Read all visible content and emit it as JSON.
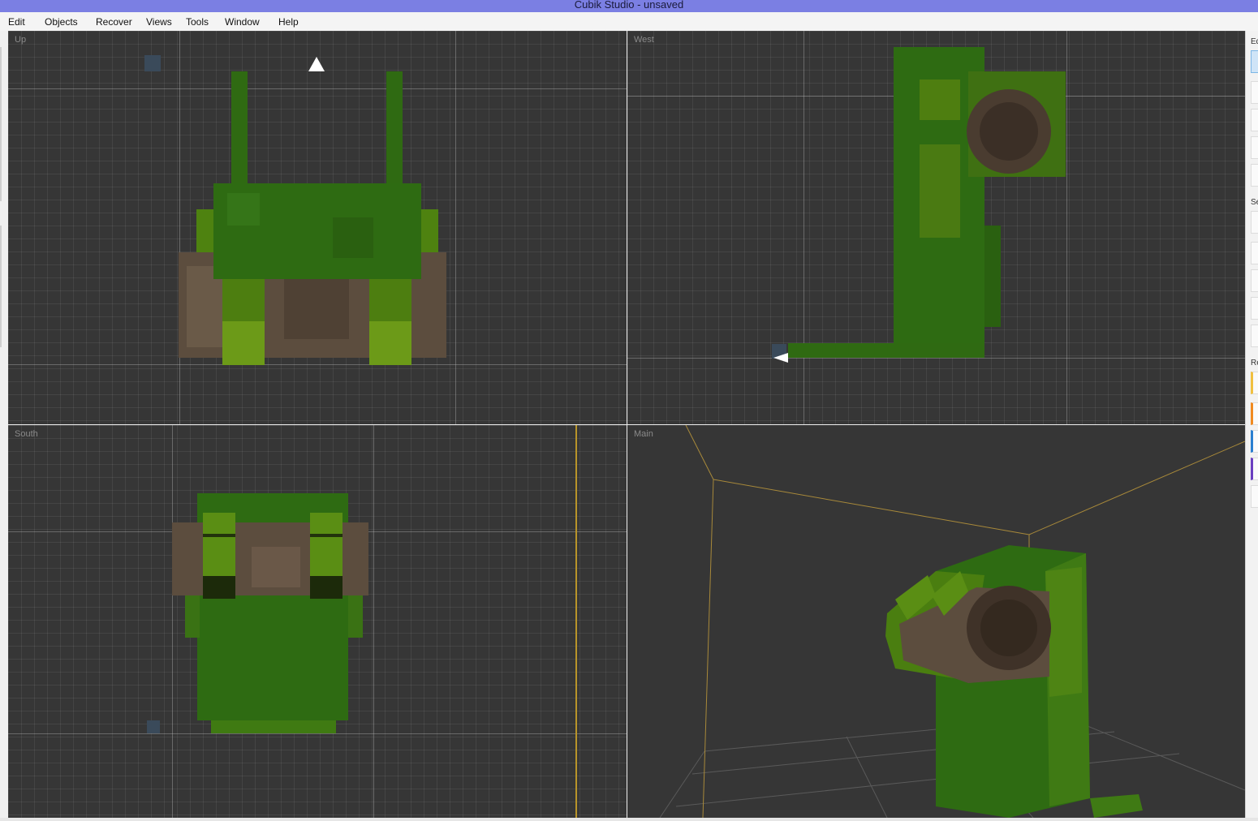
{
  "window": {
    "title": "Cubik Studio - unsaved"
  },
  "menu": {
    "items": [
      {
        "label": "Edit"
      },
      {
        "label": "Objects"
      },
      {
        "label": "Recover"
      },
      {
        "label": "Views"
      },
      {
        "label": "Tools"
      },
      {
        "label": "Window"
      },
      {
        "label": "Help"
      }
    ]
  },
  "viewports": {
    "up": {
      "label": "Up"
    },
    "west": {
      "label": "West"
    },
    "south": {
      "label": "South"
    },
    "main": {
      "label": "Main"
    }
  },
  "right_panel": {
    "section_edit": "Ed",
    "section_select": "Se",
    "section_render": "Re"
  },
  "colors": {
    "accent_titlebar": "#7b7fe3",
    "viewport_bg": "#363636",
    "model_green": "#2e6b12",
    "model_light_green": "#5a8c10",
    "model_brown": "#5a4a3a",
    "bounding_box": "#b89a3c"
  },
  "icons": {
    "camera_marker_up": "triangle-up-icon",
    "camera_marker_west": "triangle-left-icon"
  }
}
